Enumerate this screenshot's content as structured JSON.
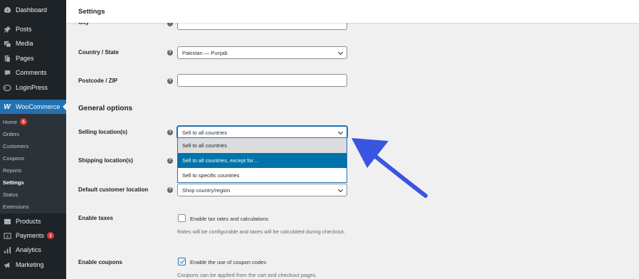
{
  "sidebar": {
    "items": [
      {
        "label": "Dashboard",
        "icon": "dashboard-icon"
      },
      {
        "label": "Posts",
        "icon": "pin-icon"
      },
      {
        "label": "Media",
        "icon": "media-icon"
      },
      {
        "label": "Pages",
        "icon": "pages-icon"
      },
      {
        "label": "Comments",
        "icon": "comments-icon"
      },
      {
        "label": "LoginPress",
        "icon": "loginpress-icon"
      }
    ],
    "woocommerce": {
      "label": "WooCommerce",
      "icon": "woocommerce-icon"
    },
    "submenu": [
      {
        "label": "Home",
        "badge": "5"
      },
      {
        "label": "Orders"
      },
      {
        "label": "Customers"
      },
      {
        "label": "Coupons"
      },
      {
        "label": "Reports"
      },
      {
        "label": "Settings"
      },
      {
        "label": "Status"
      },
      {
        "label": "Extensions"
      }
    ],
    "lower_items": [
      {
        "label": "Products",
        "icon": "products-icon"
      },
      {
        "label": "Payments",
        "icon": "payments-icon",
        "badge": "1"
      },
      {
        "label": "Analytics",
        "icon": "analytics-icon"
      },
      {
        "label": "Marketing",
        "icon": "marketing-icon"
      }
    ]
  },
  "header": {
    "title": "Settings"
  },
  "form": {
    "city": {
      "label": "City",
      "value": ""
    },
    "country_state": {
      "label": "Country / State",
      "value": "Pakistan — Punjab"
    },
    "postcode": {
      "label": "Postcode / ZIP",
      "value": ""
    },
    "general_options_title": "General options",
    "selling_locations": {
      "label": "Selling location(s)",
      "value": "Sell to all countries",
      "options": [
        "Sell to all countries",
        "Sell to all countries, except for…",
        "Sell to specific countries"
      ],
      "highlighted_option": "Sell to all countries, except for…"
    },
    "shipping_locations": {
      "label": "Shipping location(s)"
    },
    "default_customer_location": {
      "label": "Default customer location",
      "value": "Shop country/region"
    },
    "enable_taxes": {
      "label": "Enable taxes",
      "checkbox_label": "Enable tax rates and calculations",
      "checked": false,
      "description": "Rates will be configurable and taxes will be calculated during checkout."
    },
    "enable_coupons": {
      "label": "Enable coupons",
      "checkbox_label": "Enable the use of coupon codes",
      "checked": true,
      "description": "Coupons can be applied from the cart and checkout pages."
    },
    "help_icon": "?"
  },
  "colors": {
    "sidebar_bg": "#1d2327",
    "submenu_bg": "#2c3338",
    "accent": "#2271b1",
    "selected_option": "#0073aa",
    "badge": "#d63638",
    "annotation_arrow": "#3a56e0"
  }
}
